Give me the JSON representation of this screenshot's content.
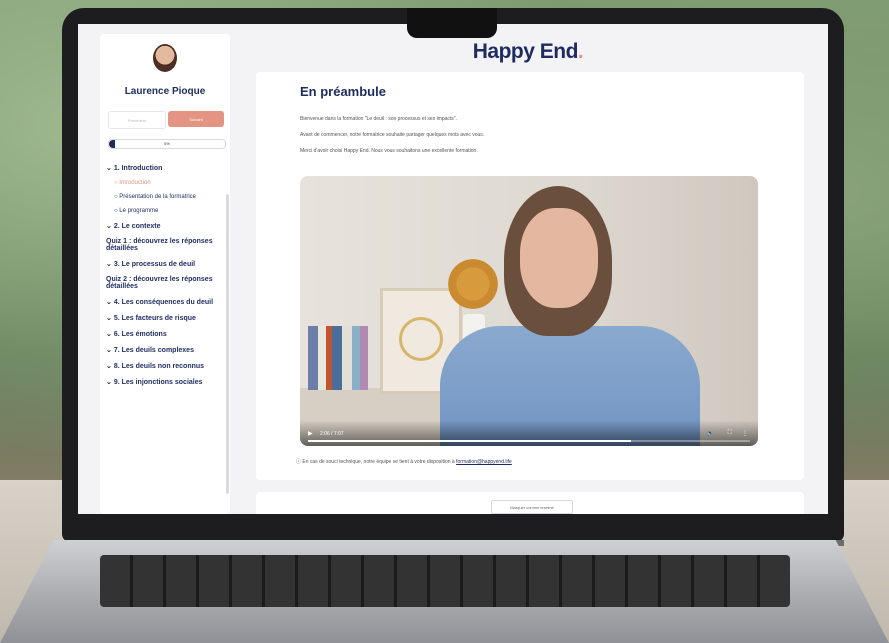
{
  "brand": {
    "name": "Happy End",
    "dot": "."
  },
  "sidebar": {
    "instructor_name": "Laurence Pioque",
    "prev_label": "Précédent",
    "next_label": "Suivant",
    "progress_label": "5%",
    "progress_value": 0.05,
    "sections": [
      {
        "label": "1. Introduction",
        "expanded": true,
        "items": [
          {
            "label": "Introduction",
            "active": true
          },
          {
            "label": "Présentation de la formatrice"
          },
          {
            "label": "Le programme"
          }
        ]
      },
      {
        "label": "2. Le contexte"
      },
      {
        "label": "Quiz 1 : découvrez les réponses détaillées"
      },
      {
        "label": "3. Le processus de deuil"
      },
      {
        "label": "Quiz 2 : découvrez les réponses détaillées"
      },
      {
        "label": "4. Les conséquences du deuil"
      },
      {
        "label": "5. Les facteurs de risque"
      },
      {
        "label": "6. Les émotions"
      },
      {
        "label": "7. Les deuils complexes"
      },
      {
        "label": "8. Les deuils non reconnus"
      },
      {
        "label": "9. Les injonctions sociales"
      }
    ]
  },
  "main": {
    "title": "En préambule",
    "paragraphs": [
      "Bienvenue dans la formation \"Le deuil : son processus et ses impacts\".",
      "Avant de commencer, notre formatrice souhaite partager quelques mots avec vous.",
      "Merci d'avoir choisi Happy End. Nous vous souhaitons une excellente formation."
    ],
    "video": {
      "time": "2:06 / 7:07",
      "progress": 0.73
    },
    "support_text": "En cas de souci technique, notre équipe se tient à votre disposition à",
    "support_email": "formation@happyend.life",
    "next_button_label": "Marquer comme terminé"
  },
  "icons": {
    "play": "play-icon",
    "volume": "volume-icon",
    "fullscreen": "fullscreen-icon",
    "menu": "more-options-icon",
    "support": "info-icon",
    "chevron": "chevron-down-icon",
    "circle": "circle-icon"
  },
  "colors": {
    "brand": "#1e2b5e",
    "accent": "#e39483"
  }
}
